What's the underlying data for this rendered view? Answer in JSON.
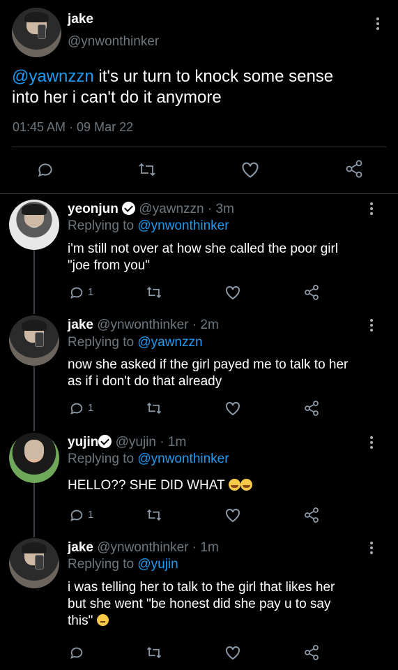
{
  "main_tweet": {
    "name": "jake",
    "handle": "@ynwonthinker",
    "mention": "@yawnzzn",
    "text_line1": " it's ur turn to knock some sense",
    "text_line2": "into her i can't do it anymore",
    "timestamp": "01:45 AM · 09 Mar 22"
  },
  "replies": [
    {
      "name": "yeonjun",
      "handle": "@yawnzzn · 3m",
      "replying_prefix": "Replying to ",
      "replying_to": "@ynwonthinker",
      "text_line1": "i'm still not over at how she called the poor girl",
      "text_line2": "\"joe from you\"",
      "reply_count": "1",
      "verified": true
    },
    {
      "name": "jake",
      "handle": "@ynwonthinker · 2m",
      "replying_prefix": "Replying to ",
      "replying_to": "@yawnzzn",
      "text_line1": "now she asked if the girl payed me to talk to her",
      "text_line2": "as if i don't do that already",
      "reply_count": "1"
    },
    {
      "name": "yujin",
      "handle": "@yujin · 1m",
      "replying_prefix": "Replying to ",
      "replying_to": "@ynwonthinker",
      "text_line1": "HELLO?? SHE DID WHAT ",
      "reply_count": "1",
      "verified": true,
      "emoji": "crying-laughing-emoji x2"
    },
    {
      "name": "jake",
      "handle": "@ynwonthinker · 1m",
      "replying_prefix": "Replying to ",
      "replying_to": "@yujin",
      "text_line1": "i was telling her to talk to the girl that likes her",
      "text_line2": "but she went \"be honest did she pay u to say",
      "text_line3": "this\" ",
      "emoji": "neutral-face-emoji"
    }
  ],
  "colors": {
    "background": "#000000",
    "link_blue": "#1d9bf0",
    "secondary_text": "#6e767d",
    "icon_grey": "#8b98a5"
  }
}
